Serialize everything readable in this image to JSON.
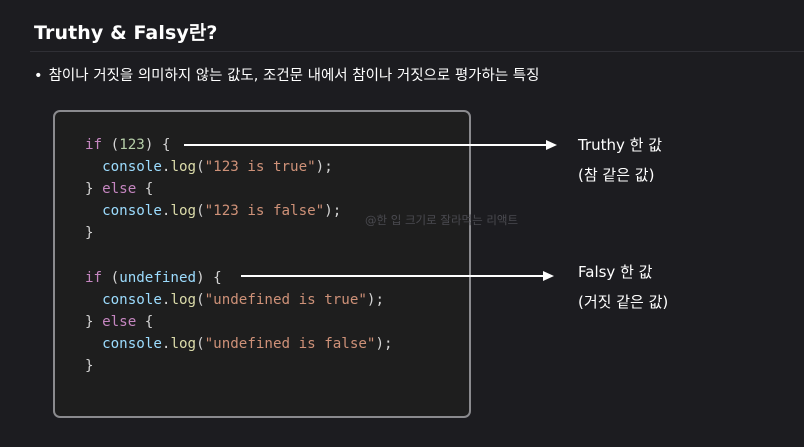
{
  "title": "Truthy & Falsy란?",
  "bullet": {
    "marker": "•",
    "text": "참이나 거짓을 의미하지 않는 값도, 조건문 내에서 참이나 거짓으로 평가하는 특징"
  },
  "code": {
    "line1": {
      "kw": "if",
      "open": " (",
      "value": "123",
      "close": ") {"
    },
    "line2": {
      "indent": "  ",
      "obj": "console",
      "dot": ".",
      "fn": "log",
      "open": "(",
      "str": "\"123 is true\"",
      "close": ");"
    },
    "line3": {
      "brace": "} ",
      "kw": "else",
      "open": " {"
    },
    "line4": {
      "indent": "  ",
      "obj": "console",
      "dot": ".",
      "fn": "log",
      "open": "(",
      "str": "\"123 is false\"",
      "close": ");"
    },
    "line5": {
      "brace": "}"
    },
    "line7": {
      "kw": "if",
      "open": " (",
      "value": "undefined",
      "close": ") {"
    },
    "line8": {
      "indent": "  ",
      "obj": "console",
      "dot": ".",
      "fn": "log",
      "open": "(",
      "str": "\"undefined is true\"",
      "close": ");"
    },
    "line9": {
      "brace": "} ",
      "kw": "else",
      "open": " {"
    },
    "line10": {
      "indent": "  ",
      "obj": "console",
      "dot": ".",
      "fn": "log",
      "open": "(",
      "str": "\"undefined is false\"",
      "close": ");"
    },
    "line11": {
      "brace": "}"
    }
  },
  "watermark": "@한 입 크기로 잘라먹는 리액트",
  "annotations": {
    "truthy": {
      "line1": "Truthy 한 값",
      "line2": "(참 같은 값)"
    },
    "falsy": {
      "line1": "Falsy 한 값",
      "line2": "(거짓 같은 값)"
    }
  },
  "colors": {
    "background": "#1c1c20",
    "code_background": "#1e1e1e",
    "code_border": "#8a8a8e",
    "keyword": "#c586c0",
    "number": "#b5cea8",
    "variable": "#9cdcfe",
    "function": "#dcdcaa",
    "string": "#ce9178"
  }
}
